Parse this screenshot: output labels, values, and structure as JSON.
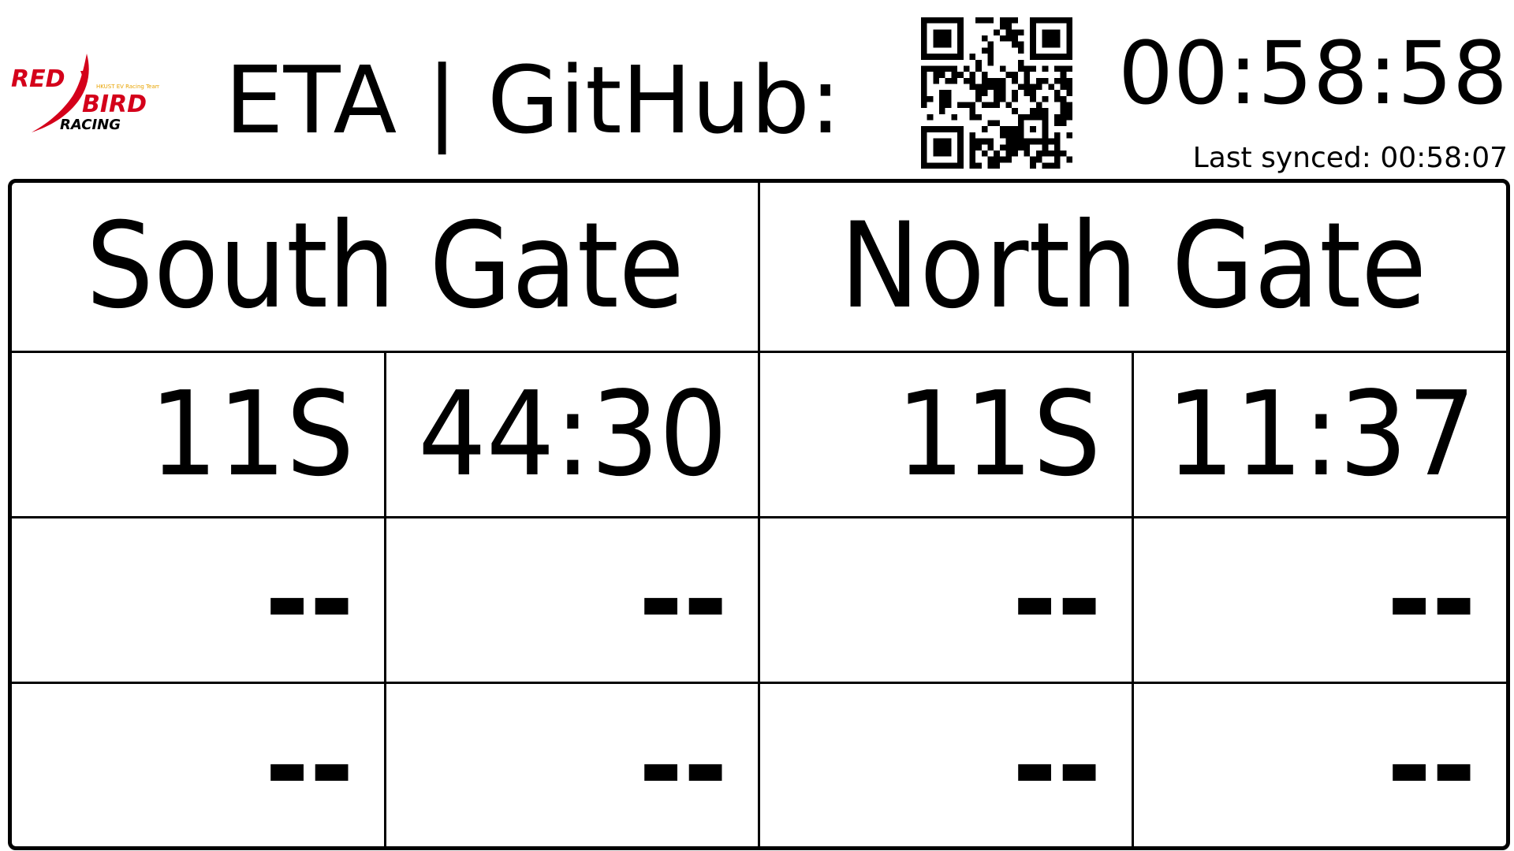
{
  "header": {
    "logo": {
      "icon": "red-bird-racing-logo",
      "line1": "RED",
      "line2": "BIRD",
      "line3": "RACING",
      "tagline": "HKUST EV Racing Team",
      "color": "#d4001a",
      "accent": "#e8a300"
    },
    "title": "ETA | GitHub:",
    "qr_icon": "qr-code-icon",
    "clock": "00:58:58",
    "last_synced": "Last synced: 00:58:07"
  },
  "board": {
    "gates": [
      {
        "name": "South Gate"
      },
      {
        "name": "North Gate"
      }
    ],
    "rows": [
      {
        "cells": [
          "11S",
          "44:30",
          "11S",
          "11:37"
        ]
      },
      {
        "cells": [
          "--",
          "--",
          "--",
          "--"
        ]
      },
      {
        "cells": [
          "--",
          "--",
          "--",
          "--"
        ]
      }
    ]
  }
}
